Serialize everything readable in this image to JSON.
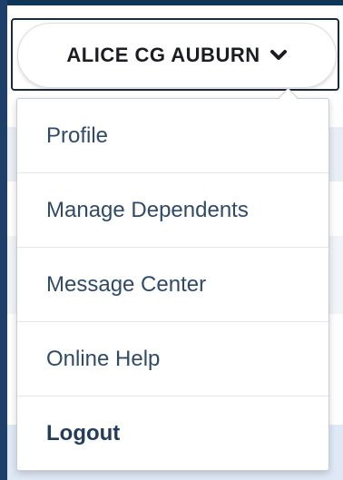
{
  "user_menu": {
    "user_name": "ALICE CG AUBURN",
    "toggle_icon": "chevron-down-icon",
    "items": [
      {
        "label": "Profile"
      },
      {
        "label": "Manage Dependents"
      },
      {
        "label": "Message Center"
      },
      {
        "label": "Online Help"
      },
      {
        "label": "Logout"
      }
    ]
  },
  "colors": {
    "nav_dark": "#0f3558",
    "menu_text": "#2f4a6b",
    "logout_text": "#243c5c",
    "name_text": "#1b1d22"
  }
}
